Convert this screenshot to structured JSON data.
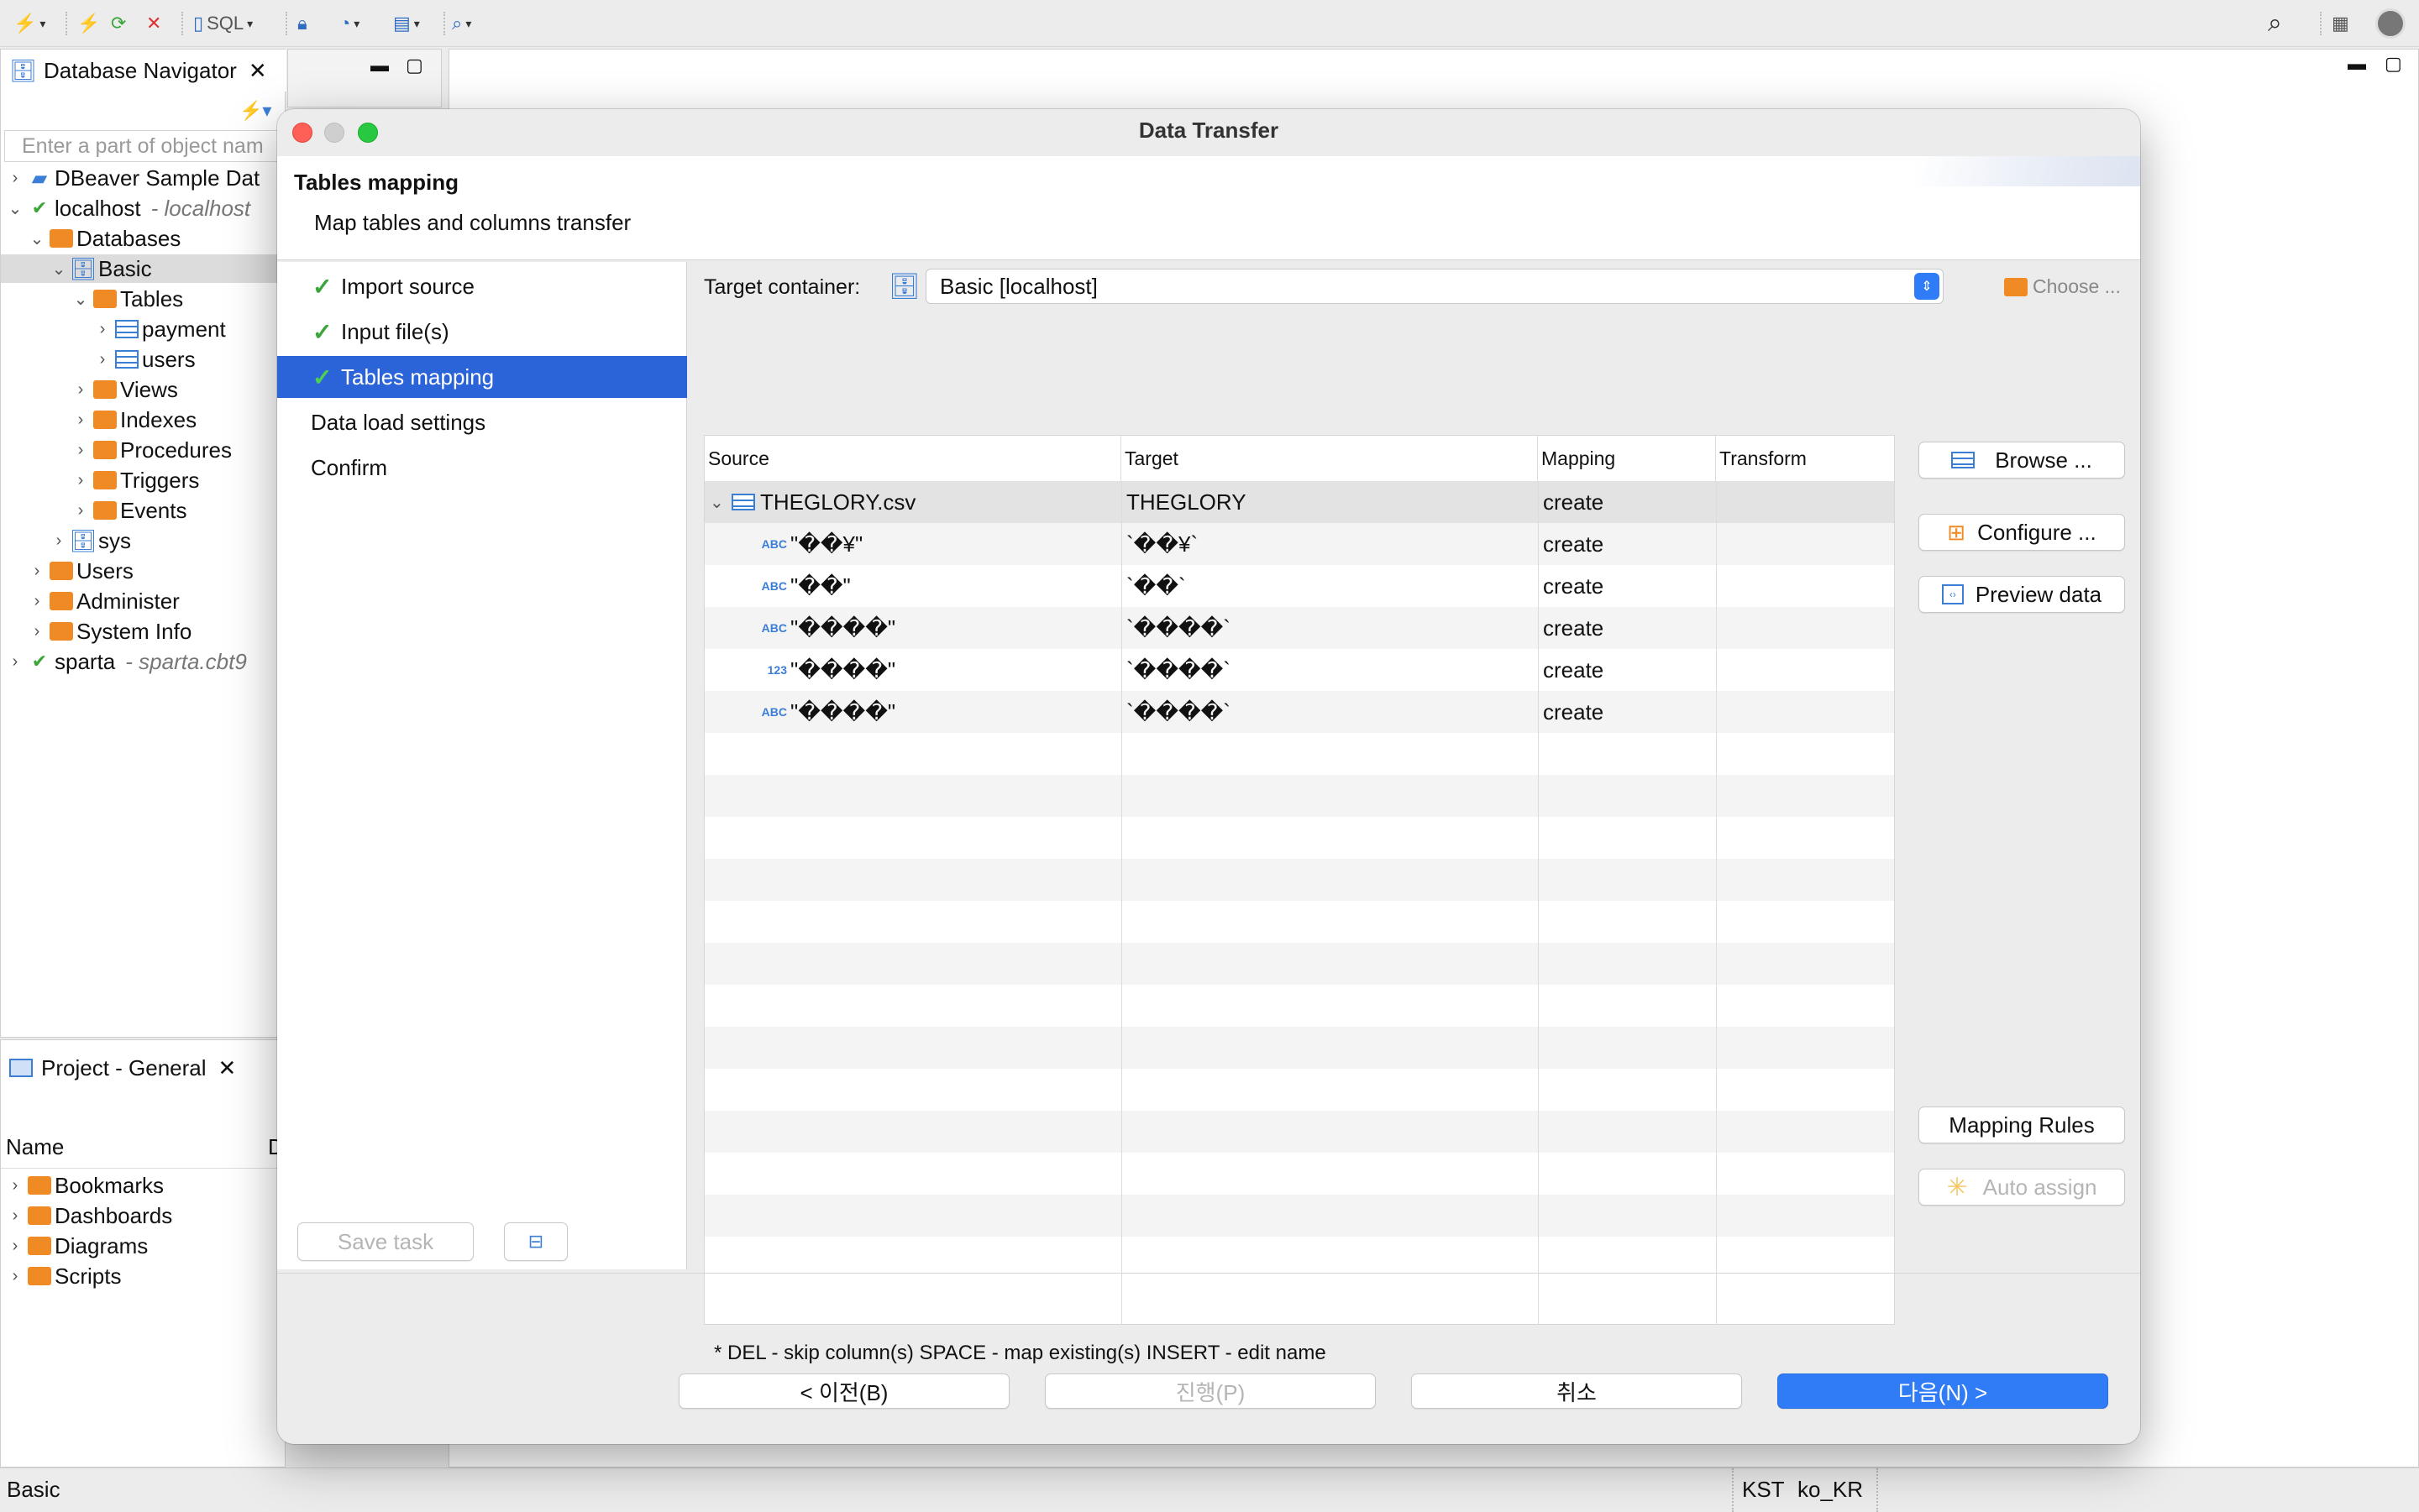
{
  "toolbar": {
    "sql_label": "SQL"
  },
  "navigator": {
    "tab_title": "Database Navigator",
    "filter_placeholder": "Enter a part of object nam",
    "items": [
      {
        "label": "DBeaver Sample Dat",
        "sub": ""
      },
      {
        "label": "localhost",
        "sub": "- localhost"
      },
      {
        "label": "Databases",
        "sub": ""
      },
      {
        "label": "Basic",
        "sub": ""
      },
      {
        "label": "Tables",
        "sub": ""
      },
      {
        "label": "payment",
        "sub": ""
      },
      {
        "label": "users",
        "sub": ""
      },
      {
        "label": "Views",
        "sub": ""
      },
      {
        "label": "Indexes",
        "sub": ""
      },
      {
        "label": "Procedures",
        "sub": ""
      },
      {
        "label": "Triggers",
        "sub": ""
      },
      {
        "label": "Events",
        "sub": ""
      },
      {
        "label": "sys",
        "sub": ""
      },
      {
        "label": "Users",
        "sub": ""
      },
      {
        "label": "Administer",
        "sub": ""
      },
      {
        "label": "System Info",
        "sub": ""
      },
      {
        "label": "sparta",
        "sub": "- sparta.cbt9"
      }
    ]
  },
  "project": {
    "tab_title": "Project - General",
    "col_name": "Name",
    "col_d": "D",
    "items": [
      "Bookmarks",
      "Dashboards",
      "Diagrams",
      "Scripts"
    ]
  },
  "dialog": {
    "title": "Data Transfer",
    "header_title": "Tables mapping",
    "header_desc": "Map tables and columns transfer",
    "steps": [
      {
        "label": "Import source",
        "done": true
      },
      {
        "label": "Input file(s)",
        "done": true
      },
      {
        "label": "Tables mapping",
        "done": true
      },
      {
        "label": "Data load settings",
        "done": false
      },
      {
        "label": "Confirm",
        "done": false
      }
    ],
    "save_task": "Save task",
    "target_container_label": "Target container:",
    "target_container_value": "Basic  [localhost]",
    "choose_label": "Choose ...",
    "columns": [
      "Source",
      "Target",
      "Mapping",
      "Transform"
    ],
    "rows": [
      {
        "type": "",
        "source": "THEGLORY.csv",
        "target": "THEGLORY",
        "mapping": "create",
        "transform": ""
      },
      {
        "type": "ABC",
        "source": "\"��¥\"",
        "target": "`��¥`",
        "mapping": "create",
        "transform": ""
      },
      {
        "type": "ABC",
        "source": "\"��\"",
        "target": "`��`",
        "mapping": "create",
        "transform": ""
      },
      {
        "type": "ABC",
        "source": "\"����\"",
        "target": "`����`",
        "mapping": "create",
        "transform": ""
      },
      {
        "type": "123",
        "source": "\"����\"",
        "target": "`����`",
        "mapping": "create",
        "transform": ""
      },
      {
        "type": "ABC",
        "source": "\"����\"",
        "target": "`����`",
        "mapping": "create",
        "transform": ""
      }
    ],
    "buttons": {
      "browse": "Browse ...",
      "configure": "Configure ...",
      "preview": "Preview data",
      "mapping_rules": "Mapping Rules",
      "auto_assign": "Auto assign"
    },
    "hint": "* DEL - skip column(s)  SPACE - map existing(s)  INSERT - edit name",
    "footer": {
      "back": "< 이전(B)",
      "proceed": "진행(P)",
      "cancel": "취소",
      "next": "다음(N) >"
    }
  },
  "statusbar": {
    "left": "Basic",
    "tz": "KST",
    "locale": "ko_KR"
  },
  "colors": {
    "accent": "#2b64d9",
    "next_button": "#2f7cf6",
    "folder": "#f08a24",
    "check": "#3aa53a"
  }
}
